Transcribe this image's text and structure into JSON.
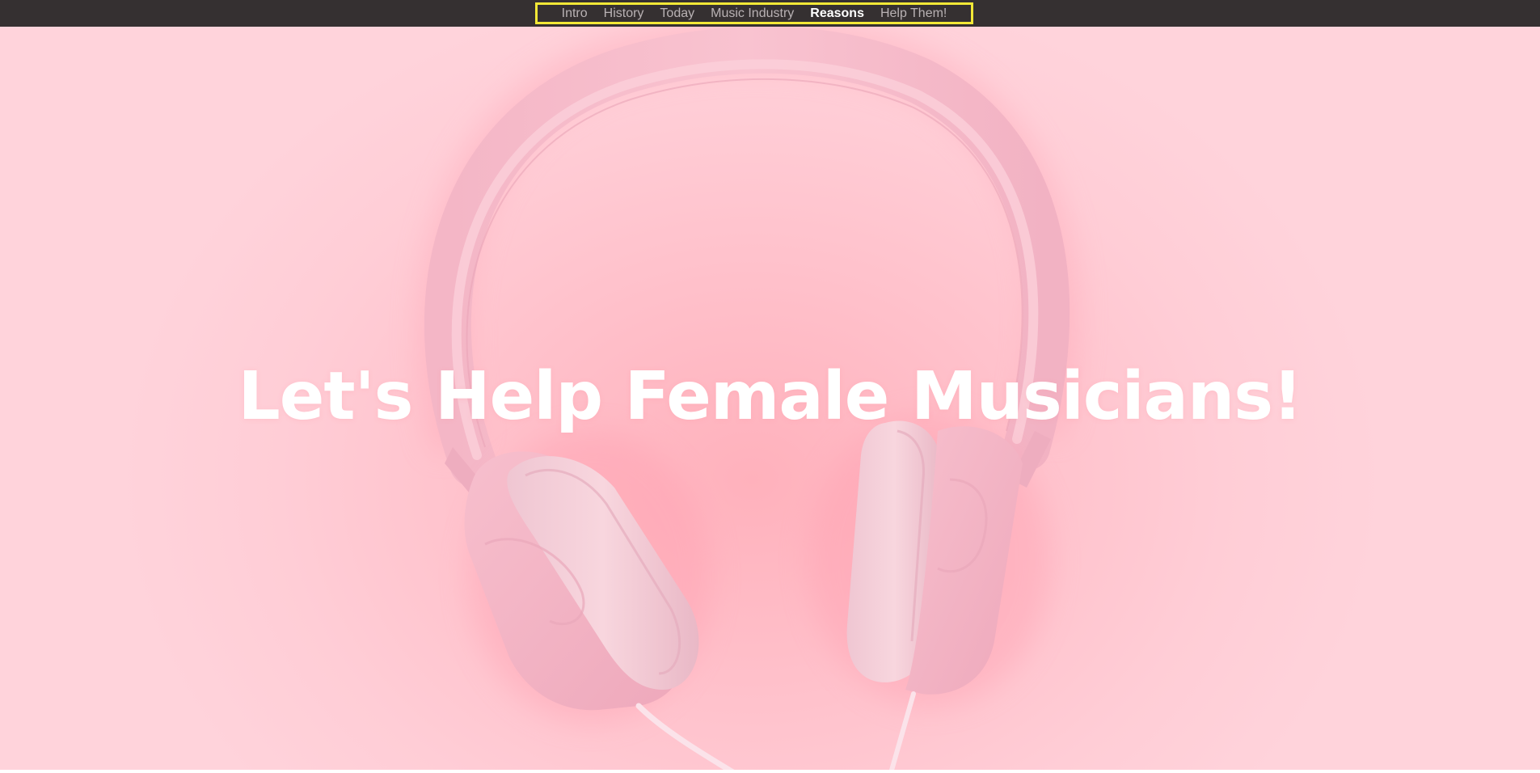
{
  "nav": {
    "items": [
      {
        "label": "Intro",
        "active": false
      },
      {
        "label": "History",
        "active": false
      },
      {
        "label": "Today",
        "active": false
      },
      {
        "label": "Music Industry",
        "active": false
      },
      {
        "label": "Reasons",
        "active": true
      },
      {
        "label": "Help Them!",
        "active": false
      }
    ]
  },
  "hero": {
    "title": "Let's Help Female Musicians!",
    "image": "pink-headphones-image"
  },
  "colors": {
    "navbar_background": "#353031",
    "nav_box_border": "#f2e837",
    "nav_link": "#b9b2b4",
    "nav_link_active": "#ffffff",
    "hero_background": "#ffc8d1",
    "headphones": "#f7b9c8",
    "title": "#ffffff"
  }
}
